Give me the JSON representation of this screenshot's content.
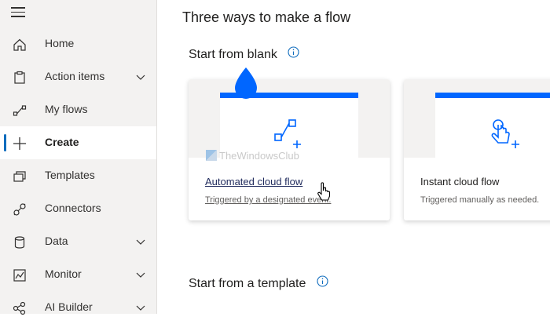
{
  "sidebar": {
    "items": [
      {
        "label": "Home",
        "icon": "home-icon"
      },
      {
        "label": "Action items",
        "icon": "clipboard-icon",
        "expandable": true
      },
      {
        "label": "My flows",
        "icon": "flow-icon"
      },
      {
        "label": "Create",
        "icon": "plus-icon",
        "active": true
      },
      {
        "label": "Templates",
        "icon": "templates-icon"
      },
      {
        "label": "Connectors",
        "icon": "connector-icon"
      },
      {
        "label": "Data",
        "icon": "database-icon",
        "expandable": true
      },
      {
        "label": "Monitor",
        "icon": "monitor-icon",
        "expandable": true
      },
      {
        "label": "AI Builder",
        "icon": "ai-builder-icon",
        "expandable": true
      }
    ]
  },
  "main": {
    "title": "Three ways to make a flow",
    "section_blank": "Start from blank",
    "section_template": "Start from a template",
    "cards": [
      {
        "title": "Automated cloud flow",
        "subtitle": "Triggered by a designated event."
      },
      {
        "title": "Instant cloud flow",
        "subtitle": "Triggered manually as needed."
      }
    ]
  },
  "watermark": "TheWindowsClub",
  "colors": {
    "accent": "#0066ff",
    "active_bar": "#0f6cbd",
    "sidebar_bg": "#f3f2f1"
  }
}
